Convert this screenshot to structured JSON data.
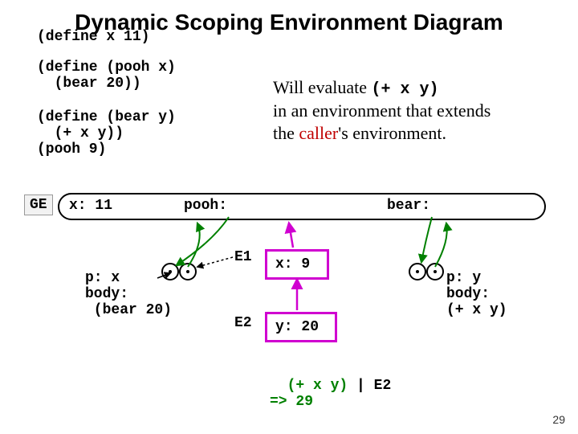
{
  "title": "Dynamic Scoping Environment Diagram",
  "defs": {
    "d1": "(define x 11)",
    "d2": "(define (pooh x)\n  (bear 20))",
    "d3": "(define (bear y)\n  (+ x y))\n(pooh 9)"
  },
  "explain": {
    "line1_a": "Will evaluate ",
    "line1_code": "(+ x y)",
    "line2": "in an environment that extends",
    "line3a": "the ",
    "line3b": "caller",
    "line3c": "'s environment."
  },
  "ge": {
    "label": "GE",
    "x": "x: 11",
    "pooh": "pooh:",
    "bear": "bear:"
  },
  "proc_pooh": "p: x\nbody:\n (bear 20)",
  "proc_bear": "p: y\nbody:\n(+ x y)",
  "env": {
    "e1_label": "E1",
    "e1_text": "x: 9",
    "e2_label": "E2",
    "e2_text": "y: 20"
  },
  "eval": {
    "line1a": "(+ x y)",
    "line1b": " | E2",
    "line2": "=> 29"
  },
  "pagenum": "29"
}
